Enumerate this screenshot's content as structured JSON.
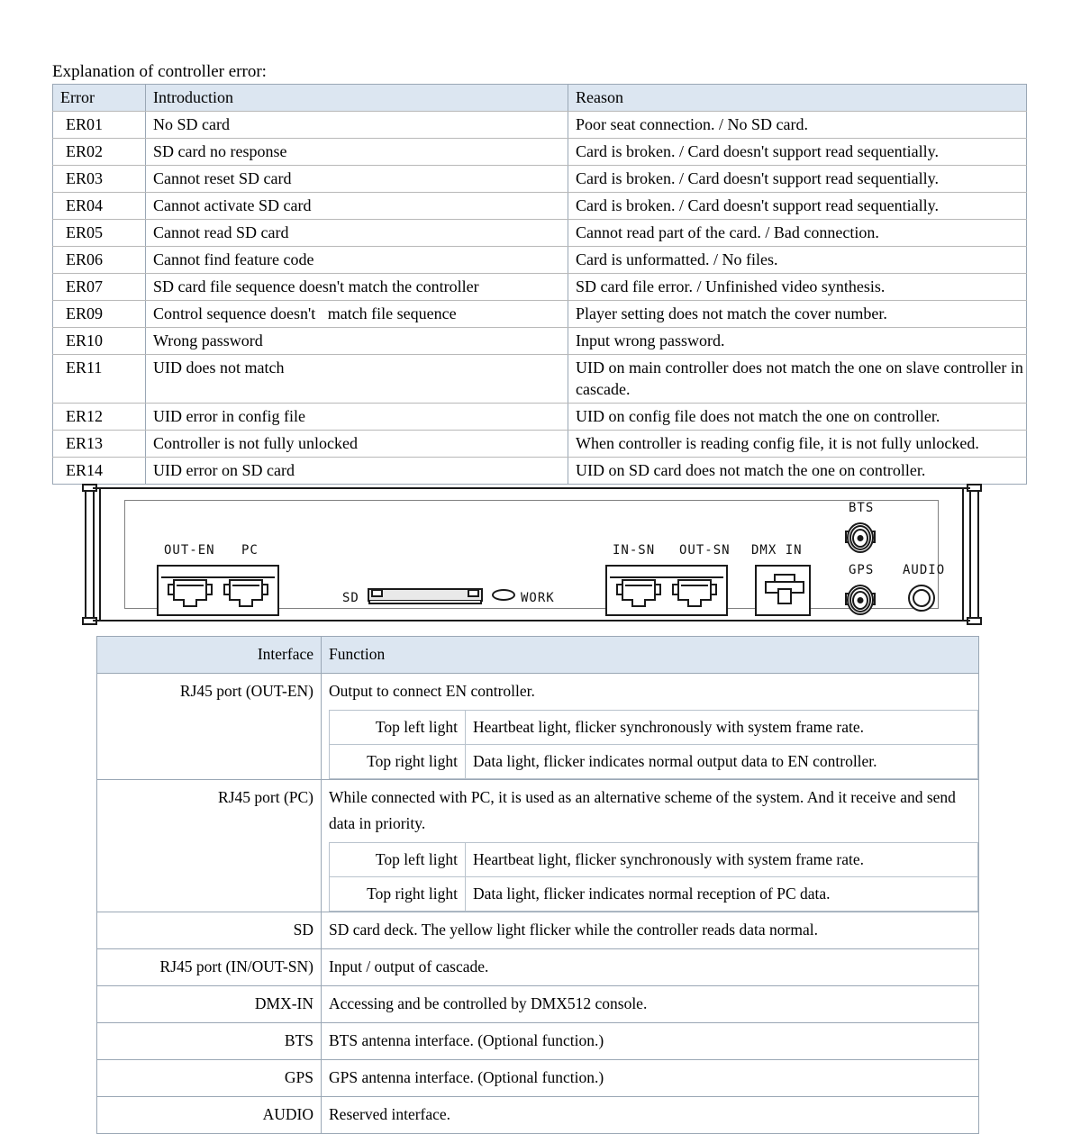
{
  "error_section": {
    "title": "Explanation of controller error:",
    "headers": [
      "Error",
      "Introduction",
      "Reason"
    ],
    "rows": [
      {
        "code": "ER01",
        "introduction": "No SD card",
        "reason": "Poor seat connection. / No SD card."
      },
      {
        "code": "ER02",
        "introduction": "SD card no response",
        "reason": "Card is broken. / Card doesn't support read sequentially."
      },
      {
        "code": "ER03",
        "introduction": "Cannot reset SD card",
        "reason": "Card is broken. / Card doesn't support read sequentially."
      },
      {
        "code": "ER04",
        "introduction": "Cannot activate SD card",
        "reason": "Card is broken. / Card doesn't support read sequentially."
      },
      {
        "code": "ER05",
        "introduction": "Cannot read SD card",
        "reason": "Cannot read part of the card. / Bad connection."
      },
      {
        "code": "ER06",
        "introduction": "Cannot find feature code",
        "reason": "Card is unformatted. / No files."
      },
      {
        "code": "ER07",
        "introduction": "SD card file sequence doesn't match the controller",
        "reason": "SD card file error. / Unfinished video synthesis."
      },
      {
        "code": "ER09",
        "introduction": "Control sequence doesn't   match file sequence",
        "reason": "Player setting does not match the cover number."
      },
      {
        "code": "ER10",
        "introduction": "Wrong password",
        "reason": "Input wrong password."
      },
      {
        "code": "ER11",
        "introduction": "UID does not match",
        "reason": "UID on main controller does not match the one on slave controller in cascade."
      },
      {
        "code": "ER12",
        "introduction": "UID error in config file",
        "reason": "UID on config file does not match the one on controller."
      },
      {
        "code": "ER13",
        "introduction": "Controller is not fully unlocked",
        "reason": "When controller is reading config file, it is not fully unlocked."
      },
      {
        "code": "ER14",
        "introduction": "UID error on SD card",
        "reason": "UID on SD card does not match the one on controller."
      }
    ]
  },
  "panel": {
    "labels": {
      "out_en": "OUT-EN",
      "pc": "PC",
      "sd": "SD",
      "work": "WORK",
      "in_sn": "IN-SN",
      "out_sn": "OUT-SN",
      "dmx_in": "DMX  IN",
      "bts": "BTS",
      "gps": "GPS",
      "audio": "AUDIO"
    }
  },
  "interface_section": {
    "headers": [
      "Interface",
      "Function"
    ],
    "rows": [
      {
        "name": "RJ45 port (OUT-EN)",
        "function": "Output to connect EN controller.",
        "sub": [
          {
            "label": "Top left light",
            "desc": "Heartbeat light, flicker synchronously with system frame rate."
          },
          {
            "label": "Top right light",
            "desc": "Data light, flicker indicates normal output data to EN controller."
          }
        ]
      },
      {
        "name": "RJ45 port (PC)",
        "function": "While connected with PC, it is used as an alternative scheme of the system. And it receive and send data in priority.",
        "sub": [
          {
            "label": "Top left light",
            "desc": "Heartbeat light, flicker synchronously with system frame rate."
          },
          {
            "label": "Top right light",
            "desc": "Data light, flicker indicates normal reception of PC data."
          }
        ]
      },
      {
        "name": "SD",
        "function": "SD card deck. The yellow light flicker while the controller reads data normal.",
        "sub": []
      },
      {
        "name": "RJ45 port (IN/OUT-SN)",
        "function": "Input / output of cascade.",
        "sub": []
      },
      {
        "name": "DMX-IN",
        "function": "Accessing and be controlled by DMX512 console.",
        "sub": []
      },
      {
        "name": "BTS",
        "function": "BTS antenna interface. (Optional function.)",
        "sub": []
      },
      {
        "name": "GPS",
        "function": "GPS antenna interface. (Optional function.)",
        "sub": []
      },
      {
        "name": "AUDIO",
        "function": "Reserved interface.",
        "sub": []
      }
    ]
  },
  "colors": {
    "header_fill": "#dce6f1",
    "border": "#9aa7b5",
    "row_divider": "#b8b8b8",
    "drawing_line": "#1a1a1a"
  }
}
